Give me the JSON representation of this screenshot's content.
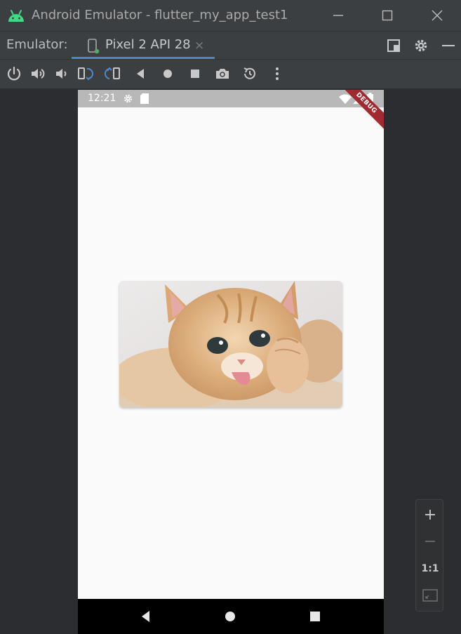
{
  "window": {
    "title": "Android Emulator - flutter_my_app_test1",
    "minimize_label": "minimize",
    "maximize_label": "maximize",
    "close_label": "close"
  },
  "tabbar": {
    "label": "Emulator:",
    "tab": {
      "label": "Pixel 2 API 28",
      "close": "×"
    }
  },
  "toolbar": {
    "items": [
      "power-icon",
      "volume-up-icon",
      "volume-down-icon",
      "rotate-left-icon",
      "rotate-right-icon",
      "back-icon",
      "home-icon",
      "overview-icon",
      "camera-icon",
      "snapshot-icon",
      "more-icon"
    ]
  },
  "device": {
    "status_time": "12:21",
    "debug_banner": "DEBUG",
    "image_subject": "kitten"
  },
  "zoom": {
    "zoom_in": "+",
    "zoom_out": "−",
    "ratio": "1:1"
  },
  "colors": {
    "accent": "#4a88c7",
    "android_green": "#3ddc84",
    "debug_red": "#a02a2f"
  }
}
